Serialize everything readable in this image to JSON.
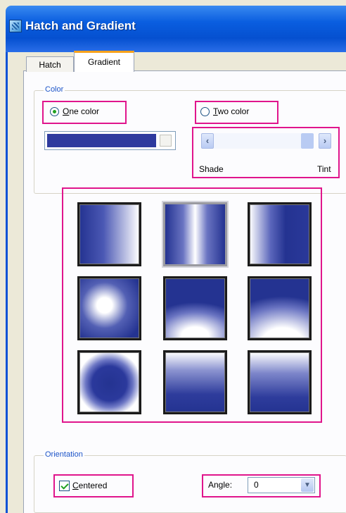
{
  "window": {
    "title": "Hatch and Gradient"
  },
  "tabs": [
    {
      "label": "Hatch",
      "active": false
    },
    {
      "label": "Gradient",
      "active": true
    }
  ],
  "color_group": {
    "label": "Color",
    "one_color": {
      "mnemonic": "O",
      "rest": "ne color",
      "checked": true
    },
    "two_color": {
      "mnemonic": "T",
      "rest": "wo color",
      "checked": false
    },
    "swatch_color": "#2e3a9e",
    "shade_label": "Shade",
    "tint_label": "Tint",
    "scroll_left": "‹",
    "scroll_right": "›"
  },
  "gradient_patterns": [
    {
      "name": "linear",
      "selected": false
    },
    {
      "name": "cylinder",
      "selected": true
    },
    {
      "name": "inverted-cylinder",
      "selected": false
    },
    {
      "name": "spherical",
      "selected": false
    },
    {
      "name": "hemispherical",
      "selected": false
    },
    {
      "name": "curved",
      "selected": false
    },
    {
      "name": "inverted-spherical",
      "selected": false
    },
    {
      "name": "inverted-hemispherical",
      "selected": false
    },
    {
      "name": "inverted-curved",
      "selected": false
    }
  ],
  "orientation_group": {
    "label": "Orientation",
    "centered": {
      "mnemonic": "C",
      "rest": "entered",
      "checked": true
    },
    "angle_label": "Angle:",
    "angle_value": "0",
    "dropdown_arrow": "▼"
  },
  "highlight_color": "#e0158c"
}
